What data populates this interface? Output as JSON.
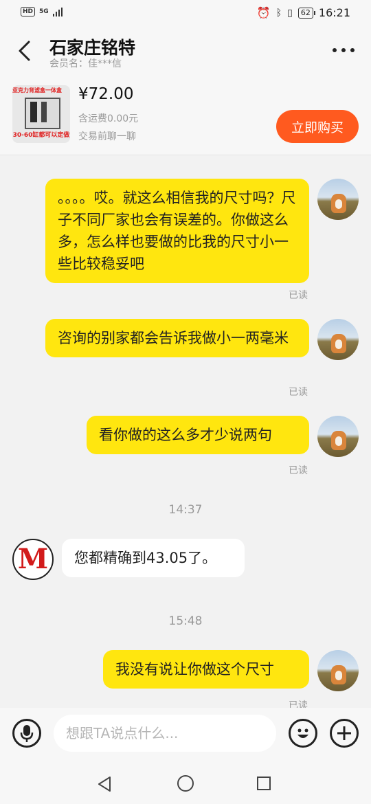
{
  "status_bar": {
    "left_badge": "HD",
    "network": "5G",
    "battery": "62",
    "time": "16:21",
    "icons": [
      "alarm-icon",
      "bluetooth-icon",
      "vibrate-icon"
    ]
  },
  "header": {
    "shop_name": "石家庄铭特",
    "member_label": "会员名：佳***信"
  },
  "product": {
    "thumb_caption_top": "亚克力背滤盒一体盒",
    "thumb_caption_bottom": "30-60缸都可以定做",
    "price": "¥72.00",
    "shipping": "含运费0.00元",
    "chat_note": "交易前聊一聊",
    "buy_label": "立即购买"
  },
  "messages": [
    {
      "side": "out",
      "text": "。。。。哎。就这么相信我的尺寸吗？尺子不同厂家也会有误差的。你做这么多，怎么样也要做的比我的尺寸小一些比较稳妥吧",
      "status": "已读"
    },
    {
      "side": "out",
      "text": "咨询的别家都会告诉我做小一两毫米",
      "status": "已读"
    },
    {
      "side": "out",
      "text": "看你做的这么多才少说两句",
      "status": "已读"
    },
    {
      "time": "14:37"
    },
    {
      "side": "in",
      "text": "您都精确到43.05了。",
      "avatar_letter": "M"
    },
    {
      "time": "15:48"
    },
    {
      "side": "out",
      "text": "我没有说让你做这个尺寸",
      "status": "已读"
    }
  ],
  "input": {
    "placeholder": "想跟TA说点什么..."
  },
  "colors": {
    "outgoing_bubble": "#ffe60f",
    "incoming_bubble": "#ffffff",
    "buy_button": "#ff5a1f",
    "background": "#f2f2f2"
  }
}
